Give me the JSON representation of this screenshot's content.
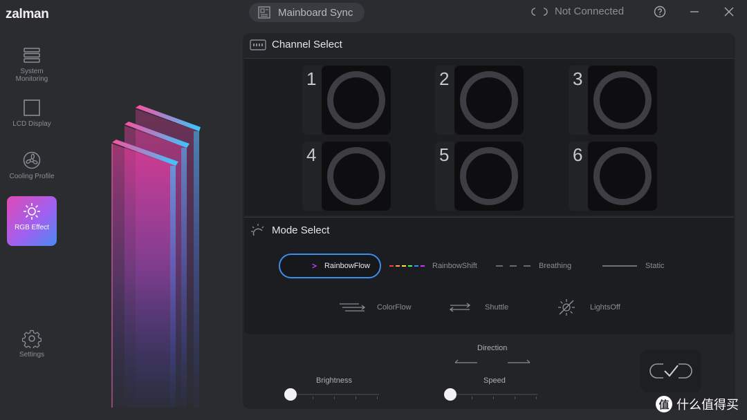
{
  "app": {
    "brand": "zalman"
  },
  "topbar": {
    "sync_label": "Mainboard Sync",
    "connection_status": "Not Connected"
  },
  "sidebar": {
    "items": [
      {
        "label": "System Monitoring",
        "icon": "stack-icon"
      },
      {
        "label": "LCD Display",
        "icon": "square-icon"
      },
      {
        "label": "Cooling Profile",
        "icon": "fan-icon"
      },
      {
        "label": "RGB Effect",
        "icon": "sun-icon",
        "active": true
      },
      {
        "label": "Settings",
        "icon": "gear-icon"
      }
    ]
  },
  "channel_select": {
    "title": "Channel Select",
    "channels": [
      "1",
      "2",
      "3",
      "4",
      "5",
      "6"
    ]
  },
  "mode_select": {
    "title": "Mode Select",
    "modes": [
      {
        "label": "RainbowFlow",
        "active": true
      },
      {
        "label": "RainbowShift"
      },
      {
        "label": "Breathing"
      },
      {
        "label": "Static"
      },
      {
        "label": "ColorFlow"
      },
      {
        "label": "Shuttle"
      },
      {
        "label": "LightsOff"
      }
    ]
  },
  "controls": {
    "direction_label": "Direction",
    "brightness_label": "Brightness",
    "speed_label": "Speed",
    "brightness_value": 0,
    "speed_value": 0
  },
  "watermark": {
    "badge": "值",
    "text": "什么值得买"
  },
  "colors": {
    "accent": "#3d8cf0",
    "active_gradient_start": "#e04ab4",
    "active_gradient_end": "#4a8af0"
  }
}
